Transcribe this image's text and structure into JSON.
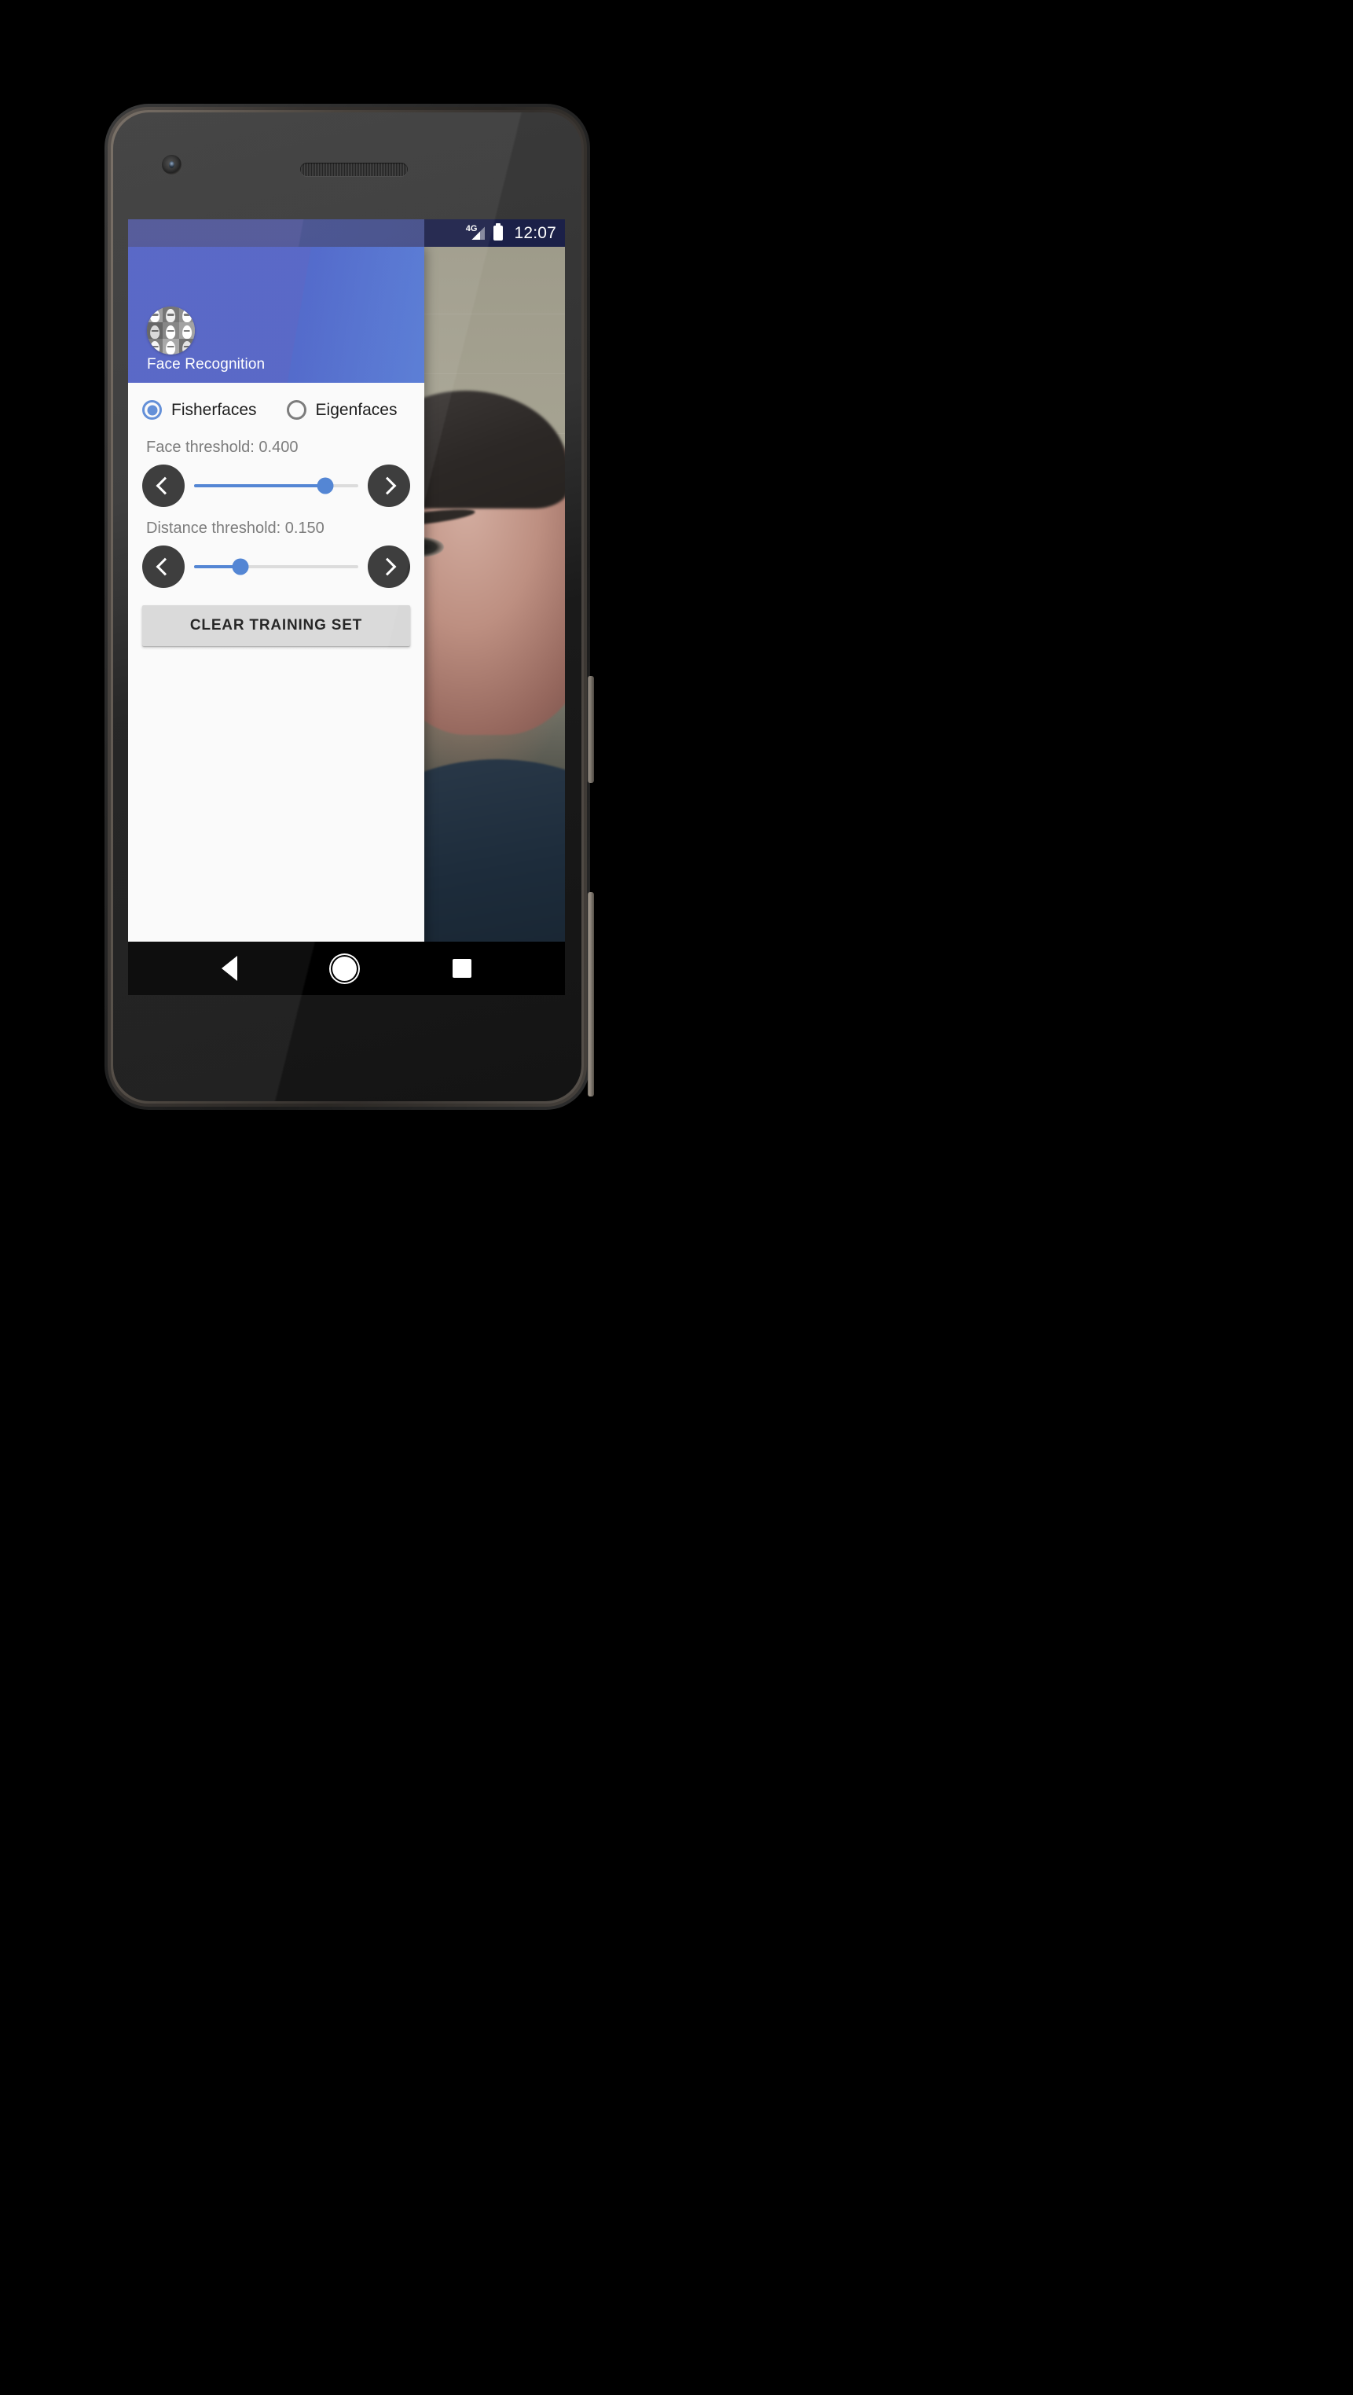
{
  "statusbar": {
    "network_label": "4G",
    "time": "12:07",
    "signal_icon": "signal-triangle-icon",
    "battery_icon": "battery-full-icon"
  },
  "drawer": {
    "app_icon": "faces-montage-icon",
    "app_title": "Face Recognition",
    "header_color": "#5160c4",
    "accent_color": "#4a7fd1",
    "algorithm": {
      "options": [
        {
          "label": "Fisherfaces",
          "selected": true
        },
        {
          "label": "Eigenfaces",
          "selected": false
        }
      ]
    },
    "settings": [
      {
        "label": "Face threshold: 0.400",
        "value": 0.4,
        "fill_percent": 80,
        "decrement_icon": "chevron-left-icon",
        "increment_icon": "chevron-right-icon"
      },
      {
        "label": "Distance threshold: 0.150",
        "value": 0.15,
        "fill_percent": 28,
        "decrement_icon": "chevron-left-icon",
        "increment_icon": "chevron-right-icon"
      }
    ],
    "clear_button_label": "CLEAR TRAINING SET"
  },
  "navbar": {
    "back_icon": "back-triangle-icon",
    "home_icon": "home-circle-icon",
    "recents_icon": "recents-square-icon"
  },
  "device": {
    "front_camera_icon": "front-camera-icon",
    "earpiece_icon": "earpiece-speaker-icon",
    "sensor_icon": "proximity-sensor-icon",
    "power_button": "power-button",
    "volume_button": "volume-button"
  },
  "camera_preview": {
    "description": "front-camera-live-preview"
  }
}
